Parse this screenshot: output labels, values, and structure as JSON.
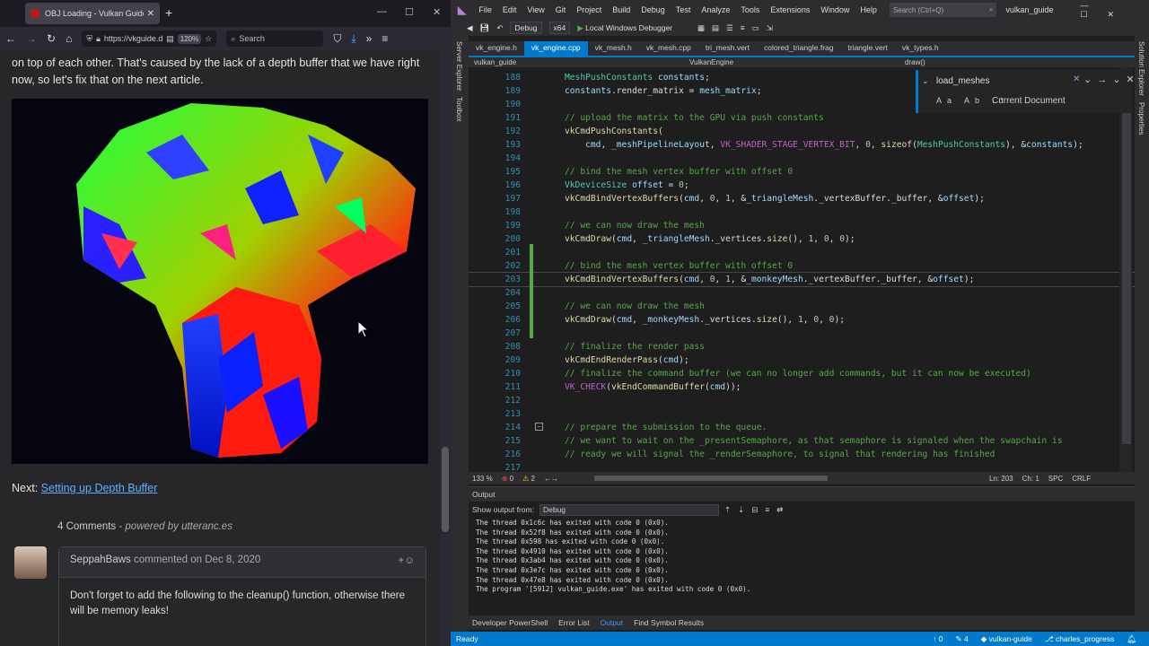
{
  "browser": {
    "tab_title": "OBJ Loading - Vulkan Guide",
    "url": "https://vkguide.d",
    "zoom": "120%",
    "search_placeholder": "Search",
    "window_controls": [
      "—",
      "☐",
      "✕"
    ]
  },
  "page": {
    "intro_text": "on top of each other. That's caused by the lack of a depth buffer that we have right now, so let's fix that on the next article.",
    "next_label": "Next:",
    "next_link": "Setting up Depth Buffer",
    "comments_count": "4 Comments",
    "comments_powered": "- powered by utteranc.es",
    "comment": {
      "author": "SeppahBaws",
      "action": "commented on Dec 8, 2020",
      "body": "Don't forget to add the following to the cleanup() function, otherwise there will be memory leaks!"
    }
  },
  "vs": {
    "menu": [
      "File",
      "Edit",
      "View",
      "Git",
      "Project",
      "Build",
      "Debug",
      "Test",
      "Analyze",
      "Tools",
      "Extensions",
      "Window",
      "Help"
    ],
    "search_placeholder": "Search (Ctrl+Q)",
    "solution": "vulkan_guide",
    "toolbar": {
      "config": "Debug",
      "platform": "x64",
      "run": "Local Windows Debugger"
    },
    "side_labels": {
      "left1": "Server Explorer",
      "left2": "Toolbox",
      "right1": "Solution Explorer",
      "right2": "Properties"
    },
    "tabs": [
      "vk_engine.h",
      "vk_engine.cpp",
      "vk_mesh.h",
      "vk_mesh.cpp",
      "tri_mesh.vert",
      "colored_triangle.frag",
      "triangle.vert",
      "vk_types.h"
    ],
    "active_tab": "vk_engine.cpp",
    "nav": {
      "project": "vulkan_guide",
      "scope": "VulkanEngine",
      "member": "draw()"
    },
    "find": {
      "query": "load_meshes",
      "scope": "Current Document",
      "options": "Aa Ab .*"
    },
    "code_lines": [
      {
        "n": "188",
        "t": "        MeshPushConstants constants;"
      },
      {
        "n": "189",
        "t": "        constants.render_matrix = mesh_matrix;"
      },
      {
        "n": "190",
        "t": ""
      },
      {
        "n": "191",
        "t": "        // upload the matrix to the GPU via push constants"
      },
      {
        "n": "192",
        "t": "        vkCmdPushConstants("
      },
      {
        "n": "193",
        "t": "            cmd, _meshPipelineLayout, VK_SHADER_STAGE_VERTEX_BIT, 0, sizeof(MeshPushConstants), &constants);"
      },
      {
        "n": "194",
        "t": ""
      },
      {
        "n": "195",
        "t": "        // bind the mesh vertex buffer with offset 0"
      },
      {
        "n": "196",
        "t": "        VkDeviceSize offset = 0;"
      },
      {
        "n": "197",
        "t": "        vkCmdBindVertexBuffers(cmd, 0, 1, &_triangleMesh._vertexBuffer._buffer, &offset);"
      },
      {
        "n": "198",
        "t": ""
      },
      {
        "n": "199",
        "t": "        // we can now draw the mesh"
      },
      {
        "n": "200",
        "t": "        vkCmdDraw(cmd, _triangleMesh._vertices.size(), 1, 0, 0);"
      },
      {
        "n": "201",
        "t": ""
      },
      {
        "n": "202",
        "t": "        // bind the mesh vertex buffer with offset 0"
      },
      {
        "n": "203",
        "t": "        vkCmdBindVertexBuffers(cmd, 0, 1, &_monkeyMesh._vertexBuffer._buffer, &offset);"
      },
      {
        "n": "204",
        "t": ""
      },
      {
        "n": "205",
        "t": "        // we can now draw the mesh"
      },
      {
        "n": "206",
        "t": "        vkCmdDraw(cmd, _monkeyMesh._vertices.size(), 1, 0, 0);"
      },
      {
        "n": "207",
        "t": ""
      },
      {
        "n": "208",
        "t": "        // finalize the render pass"
      },
      {
        "n": "209",
        "t": "        vkCmdEndRenderPass(cmd);"
      },
      {
        "n": "210",
        "t": "        // finalize the command buffer (we can no longer add commands, but it can now be executed)"
      },
      {
        "n": "211",
        "t": "        VK_CHECK(vkEndCommandBuffer(cmd));"
      },
      {
        "n": "212",
        "t": ""
      },
      {
        "n": "213",
        "t": ""
      },
      {
        "n": "214",
        "t": "        // prepare the submission to the queue."
      },
      {
        "n": "215",
        "t": "        // we want to wait on the _presentSemaphore, as that semaphore is signaled when the swapchain is"
      },
      {
        "n": "216",
        "t": "        // ready we will signal the _renderSemaphore, to signal that rendering has finished"
      },
      {
        "n": "217",
        "t": ""
      }
    ],
    "editor_status": {
      "zoom": "133 %",
      "errors": "0",
      "warnings": "2",
      "ln": "Ln: 203",
      "ch": "Ch: 1",
      "spc": "SPC",
      "crlf": "CRLF"
    },
    "output": {
      "title": "Output",
      "show_from_label": "Show output from:",
      "show_from_value": "Debug",
      "lines": [
        "The thread 0x1c6c has exited with code 0 (0x0).",
        "The thread 0x52f8 has exited with code 0 (0x0).",
        "The thread 0x598 has exited with code 0 (0x0).",
        "The thread 0x4910 has exited with code 0 (0x0).",
        "The thread 0x3ab4 has exited with code 0 (0x0).",
        "The thread 0x3e7c has exited with code 0 (0x0).",
        "The thread 0x47e8 has exited with code 0 (0x0).",
        "The program '[5912] vulkan_guide.exe' has exited with code 0 (0x0)."
      ]
    },
    "bottom_tabs": [
      "Developer PowerShell",
      "Error List",
      "Output",
      "Find Symbol Results"
    ],
    "active_bottom_tab": "Output",
    "status": {
      "ready": "Ready",
      "up": "0",
      "pencil": "4",
      "repo": "vulkan-guide",
      "branch": "charles_progress"
    }
  }
}
